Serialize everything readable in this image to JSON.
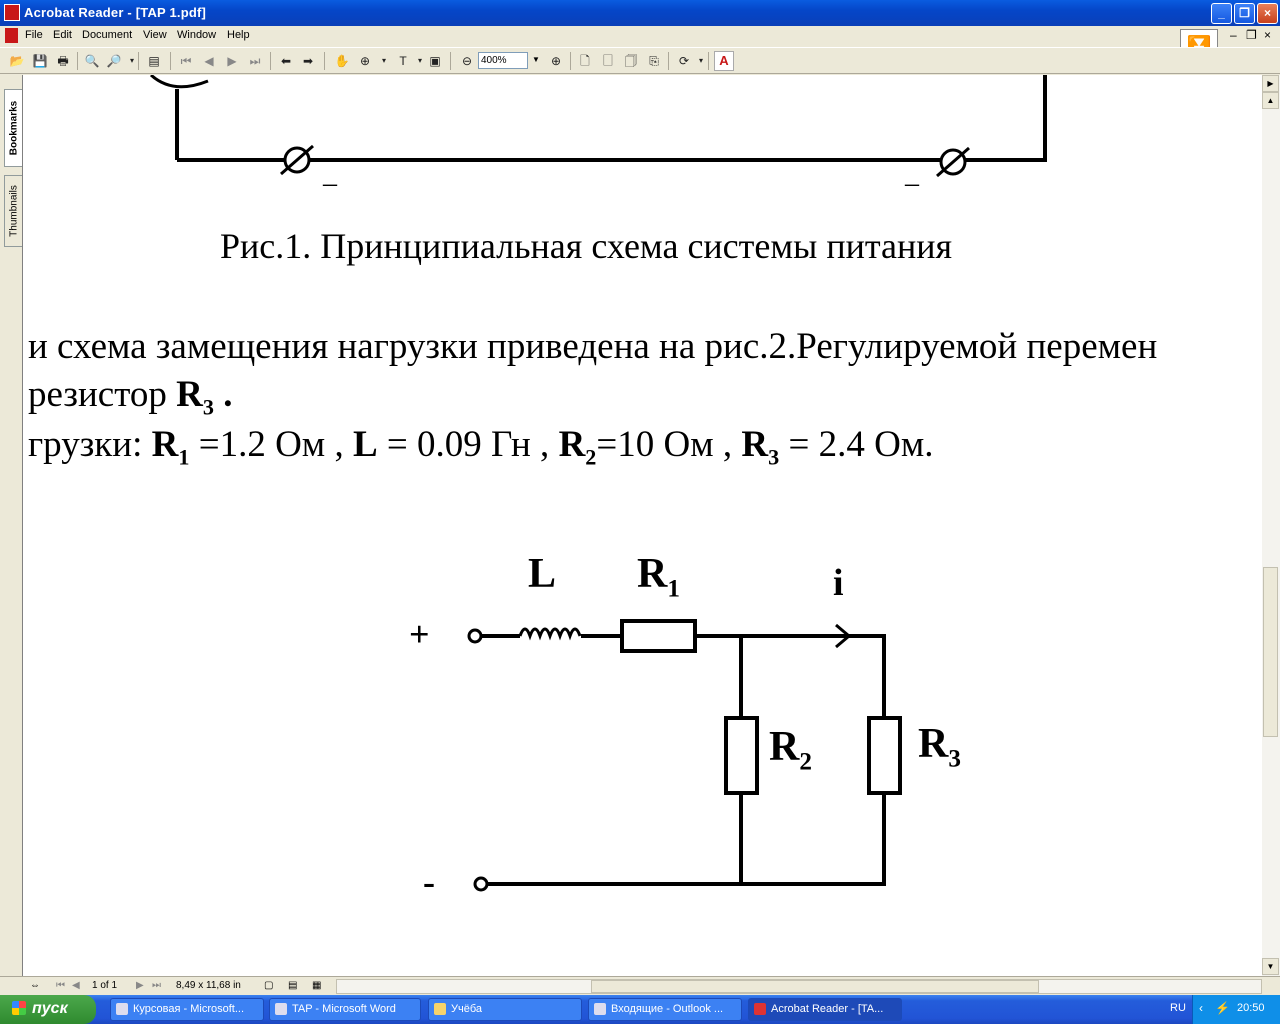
{
  "window": {
    "title": "Acrobat Reader - [TAP 1.pdf]"
  },
  "menu": [
    "File",
    "Edit",
    "Document",
    "View",
    "Window",
    "Help"
  ],
  "toolbar": {
    "zoom": "400%"
  },
  "nav_tabs": {
    "bookmarks": "Bookmarks",
    "thumbnails": "Thumbnails"
  },
  "document": {
    "fig1_minus_left": "–",
    "fig1_minus_right": "–",
    "fig1_caption": "Рис.1.  Принципиальная  схема системы питания",
    "line1": "и схема замещения нагрузки приведена на рис.2.Регулируемой перемен",
    "line2_prefix": "резистор ",
    "line2_r": "R",
    "line2_sub": "3",
    "line2_suffix": " .",
    "line3": {
      "prefix": "грузки: ",
      "r1": "R",
      "r1_sub": "1",
      "r1_val": " =1.2 Ом , ",
      "l": "L",
      "l_val": " = 0.09 Гн , ",
      "r2": "R",
      "r2_sub": "2",
      "r2_val": "=10 Ом , ",
      "r3": "R",
      "r3_sub": "3",
      "r3_val": " = 2.4 Ом."
    },
    "fig2": {
      "L": "L",
      "R1": "R",
      "R1_sub": "1",
      "i": "i",
      "plus": "+",
      "minus": "-",
      "R2": "R",
      "R2_sub": "2",
      "R3": "R",
      "R3_sub": "3"
    }
  },
  "status": {
    "page": "1 of 1",
    "size": "8,49 x 11,68 in"
  },
  "taskbar": {
    "start": "пуск",
    "tasks": [
      "Курсовая - Microsoft...",
      "TAP - Microsoft Word",
      "Учёба",
      "Входящие - Outlook ...",
      "Acrobat Reader - [TA..."
    ],
    "lang": "RU",
    "clock": "20:50"
  }
}
